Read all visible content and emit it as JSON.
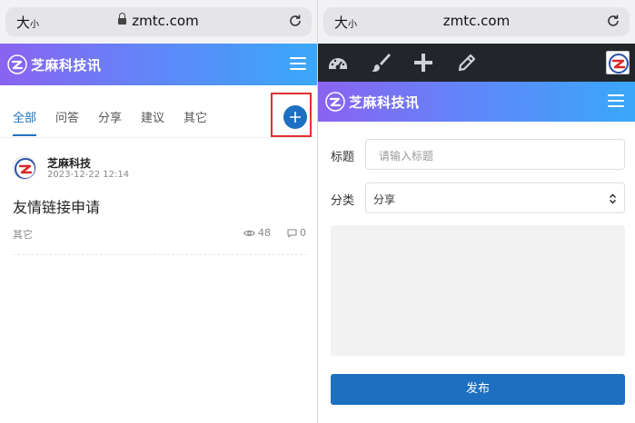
{
  "left": {
    "browser": {
      "text_size_label": "大",
      "text_size_small": "小",
      "url": "zmtc.com"
    },
    "brand": {
      "name": "芝麻科技讯"
    },
    "tabs": [
      {
        "label": "全部",
        "active": true
      },
      {
        "label": "问答",
        "active": false
      },
      {
        "label": "分享",
        "active": false
      },
      {
        "label": "建议",
        "active": false
      },
      {
        "label": "其它",
        "active": false
      }
    ],
    "post": {
      "author": "芝麻科技",
      "time": "2023-12-22 12:14",
      "title": "友情链接申请",
      "category": "其它",
      "views": "48",
      "comments": "0"
    }
  },
  "right": {
    "browser": {
      "text_size_label": "大",
      "text_size_small": "小",
      "url": "zmtc.com"
    },
    "toolbar": {
      "icons": [
        "dashboard-icon",
        "brush-icon",
        "plus-icon",
        "pencil-icon"
      ]
    },
    "brand": {
      "name": "芝麻科技讯"
    },
    "form": {
      "title_label": "标题",
      "title_placeholder": "请输入标题",
      "category_label": "分类",
      "category_value": "分享",
      "publish_label": "发布"
    }
  },
  "colors": {
    "accent": "#1d6fc1",
    "highlight": "#e0302f",
    "toolbar_bg": "#22262b",
    "brand_start": "#8a63f0",
    "brand_end": "#3aa8fb"
  }
}
